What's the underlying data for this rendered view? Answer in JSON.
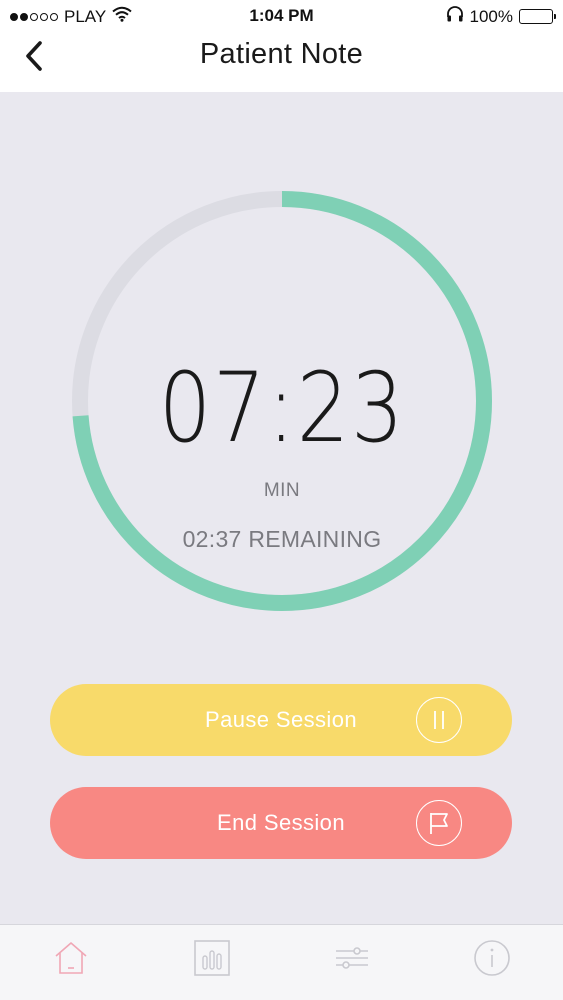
{
  "status_bar": {
    "carrier": "PLAY",
    "time": "1:04 PM",
    "battery_percent": "100%",
    "signal_bars_filled": 2,
    "signal_bars_total": 5,
    "icons": [
      "wifi-icon",
      "headphones-icon",
      "battery-icon"
    ]
  },
  "nav": {
    "title": "Patient Note",
    "back_icon": "chevron-left-icon"
  },
  "timer": {
    "elapsed": "07:23",
    "unit": "MIN",
    "remaining_text": "02:37 REMAINING",
    "progress_fraction": 0.738,
    "colors": {
      "progress": "#7fd0b5",
      "track": "#dcdce3"
    }
  },
  "actions": {
    "pause": {
      "label": "Pause Session",
      "icon": "pause-icon",
      "color": "#f8da6a"
    },
    "end": {
      "label": "End Session",
      "icon": "flag-icon",
      "color": "#f88883"
    }
  },
  "tab_bar": {
    "tabs": [
      {
        "name": "home",
        "icon": "home-icon",
        "active": true
      },
      {
        "name": "stats",
        "icon": "bar-chart-icon",
        "active": false
      },
      {
        "name": "settings",
        "icon": "sliders-icon",
        "active": false
      },
      {
        "name": "info",
        "icon": "info-icon",
        "active": false
      }
    ],
    "colors": {
      "active": "#f0a7b5",
      "inactive": "#c9c9cf"
    }
  }
}
